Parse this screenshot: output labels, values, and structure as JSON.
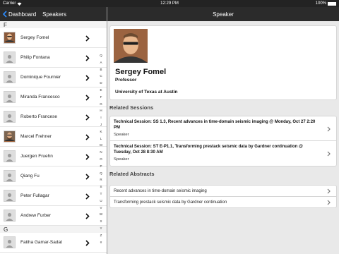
{
  "status_bar": {
    "carrier": "Carrier",
    "time": "12:29 PM",
    "battery": "100%"
  },
  "left_nav": {
    "back_label": "Dashboard",
    "title": "Speakers"
  },
  "right_nav": {
    "title": "Speaker"
  },
  "speaker_list": {
    "sections": [
      {
        "letter": "F",
        "items": [
          {
            "name": "Sergey Fomel",
            "avatar": "photo"
          },
          {
            "name": "Philip Fontana",
            "avatar": "placeholder"
          },
          {
            "name": "Dominique Fournier",
            "avatar": "placeholder"
          },
          {
            "name": "Miranda Francesco",
            "avatar": "placeholder"
          },
          {
            "name": "Roberto Francese",
            "avatar": "placeholder"
          },
          {
            "name": "Marcel Frehner",
            "avatar": "photo"
          },
          {
            "name": "Juergen Fruehn",
            "avatar": "placeholder"
          },
          {
            "name": "Qiang Fu",
            "avatar": "placeholder"
          },
          {
            "name": "Peter Fullagar",
            "avatar": "placeholder"
          },
          {
            "name": "Andrew Furber",
            "avatar": "placeholder"
          }
        ]
      },
      {
        "letter": "G",
        "items": [
          {
            "name": "Fatiha Gamar-Sadat",
            "avatar": "placeholder"
          }
        ]
      }
    ],
    "index": [
      "Q",
      "A",
      "B",
      "C",
      "D",
      "E",
      "F",
      "G",
      "H",
      "I",
      "J",
      "K",
      "L",
      "M",
      "N",
      "O",
      "P",
      "Q",
      "R",
      "S",
      "T",
      "U",
      "V",
      "W",
      "X",
      "Y",
      "Z",
      "#"
    ]
  },
  "speaker": {
    "name": "Sergey Fomel",
    "role": "Professor",
    "organization": "University of Texas at Austin"
  },
  "related_sessions": {
    "title": "Related Sessions",
    "items": [
      {
        "title": "Technical Session: SS 1.3, Recent advances in time-domain seismic imaging @ Monday, Oct 27 2:20 PM",
        "subtitle": "Speaker"
      },
      {
        "title": "Technical Session: ST E-P1.1, Transforming prestack seismic data by Gardner continuation @ Tuesday, Oct 28 8:30 AM",
        "subtitle": "Speaker"
      }
    ]
  },
  "related_abstracts": {
    "title": "Related Abstracts",
    "items": [
      {
        "title": "Recent advances in time-domain seismic imaging"
      },
      {
        "title": "Transforming prestack seismic data by Gardner continuation"
      }
    ]
  },
  "colors": {
    "nav_bar": "#2b2b2b",
    "detail_bg": "#e9e9e9",
    "accent_back": "#2b8cff"
  }
}
